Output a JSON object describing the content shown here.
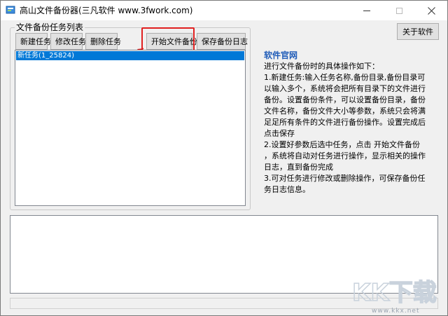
{
  "window": {
    "title": "高山文件备份器(三凡软件 www.3fwork.com)"
  },
  "toolbar": {
    "group_title": "文件备份任务列表",
    "new_task": "新建任务",
    "edit_task": "修改任务",
    "delete_task": "删除任务",
    "start_backup": "开始文件备份",
    "save_log": "保存备份日志",
    "about": "关于软件"
  },
  "tasks": {
    "items": [
      {
        "label": "新任务(1_25824)",
        "selected": true
      }
    ]
  },
  "info": {
    "link": "软件官网",
    "lines": [
      "进行文件备份时的具体操作如下：",
      "1.新建任务:输入任务名称,备份目录,备份目录可以输入多个，系统将会把所有目录下的文件进行备份。设置备份条件，可以设置备份目录，备份文件名称，备份文件大小等参数，系统只会将满足足所有条件的文件进行备份操作。设置完成后点击保存",
      "2.设置好参数后选中任务，点击 开始文件备份 ，系统将自动对任务进行操作，显示相关的操作日志，直到备份完成",
      "3.可对任务进行修改或删除操作，可保存备份任务日志信息。"
    ]
  },
  "watermark": {
    "brand": "KK下载",
    "site": "www.kkx.net"
  },
  "colors": {
    "selection": "#0078d7",
    "highlight": "#e02020",
    "link": "#1e5bb8"
  }
}
